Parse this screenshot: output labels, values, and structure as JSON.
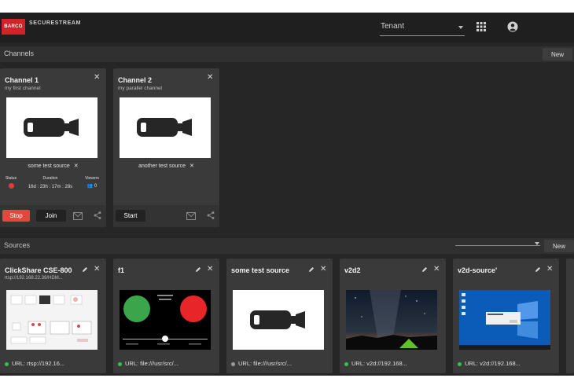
{
  "header": {
    "logo_text": "BARCO",
    "app_name": "SECURESTREAM",
    "tenant_label": "Tenant",
    "icons": [
      "apps-grid-icon",
      "account-circle-icon"
    ]
  },
  "channels_section": {
    "title": "Channels",
    "new_label": "New",
    "channels": [
      {
        "title": "Channel 1",
        "subtitle": "my first channel",
        "source": "some test source",
        "status_label": "Status",
        "duration_label": "Duration",
        "duration_value": "16d : 23h : 17m : 28s",
        "viewers_label": "Viewers",
        "viewers_value": "0",
        "primary_button": "Stop",
        "secondary_button": "Join"
      },
      {
        "title": "Channel 2",
        "subtitle": "my parallel channel",
        "source": "another test source",
        "primary_button": "Start"
      }
    ]
  },
  "sources_section": {
    "title": "Sources",
    "new_label": "New",
    "sources": [
      {
        "title": "ClickShare CSE-800",
        "subtitle": "rtsp://192.168.22.39/HDM...",
        "url": "URL: rtsp://192.16...",
        "status_color": "#3bbf4a"
      },
      {
        "title": "f1",
        "subtitle": "",
        "url": "URL: file:///usr/src/...",
        "status_color": "#3bbf4a"
      },
      {
        "title": "some test source",
        "subtitle": "",
        "url": "URL: file:///usr/src/...",
        "status_color": "#9a9a9a"
      },
      {
        "title": "v2d2",
        "subtitle": "",
        "url": "URL: v2d://192.168...",
        "status_color": "#3bbf4a"
      },
      {
        "title": "v2d-source'",
        "subtitle": "",
        "url": "URL: v2d://192.168...",
        "status_color": "#3bbf4a"
      }
    ]
  },
  "colors": {
    "accent_red": "#e2463f",
    "status_green": "#3bbf4a",
    "background": "#262626"
  }
}
